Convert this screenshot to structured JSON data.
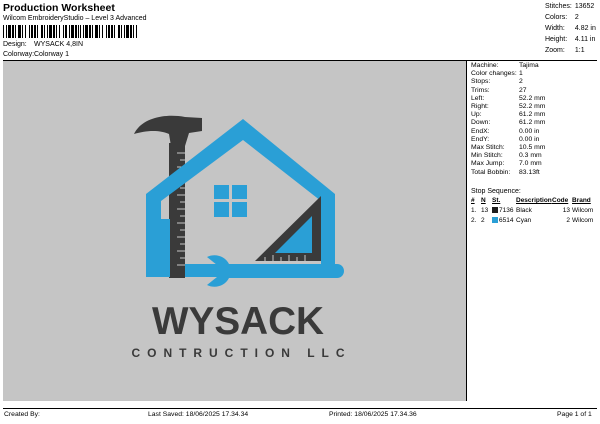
{
  "header": {
    "title": "Production Worksheet",
    "subtitle": "Wilcom EmbroideryStudio – Level 3 Advanced",
    "design_label": "Design:",
    "design_value": "WYSACK 4,8IN",
    "colorway_label": "Colorway:",
    "colorway_value": "Colorway 1"
  },
  "stats": [
    {
      "label": "Stitches:",
      "value": "13652"
    },
    {
      "label": "Colors:",
      "value": "2"
    },
    {
      "label": "Width:",
      "value": "4.82 in"
    },
    {
      "label": "Height:",
      "value": "4.11 in"
    },
    {
      "label": "Zoom:",
      "value": "1:1"
    }
  ],
  "machine_params": [
    {
      "label": "Machine:",
      "value": "Tajima"
    },
    {
      "label": "Color changes:",
      "value": "1"
    },
    {
      "label": "Stops:",
      "value": "2"
    },
    {
      "label": "Trims:",
      "value": "27"
    },
    {
      "label": "Left:",
      "value": "52.2 mm"
    },
    {
      "label": "Right:",
      "value": "52.2 mm"
    },
    {
      "label": "Up:",
      "value": "61.2 mm"
    },
    {
      "label": "Down:",
      "value": "61.2 mm"
    },
    {
      "label": "EndX:",
      "value": "0.00 in"
    },
    {
      "label": "EndY:",
      "value": "0.00 in"
    },
    {
      "label": "Max Stitch:",
      "value": "10.5 mm"
    },
    {
      "label": "Min Stitch:",
      "value": "0.3 mm"
    },
    {
      "label": "Max Jump:",
      "value": "7.0 mm"
    },
    {
      "label": "Total Bobbin:",
      "value": "83.13ft"
    }
  ],
  "stop_sequence": {
    "heading": "Stop Sequence:",
    "columns": [
      "#",
      "N",
      "St.",
      "Description",
      "Code",
      "Brand"
    ],
    "rows": [
      {
        "num": "1.",
        "n": "13",
        "st": "7136",
        "desc": "Black",
        "code": "13",
        "brand": "Wilcom",
        "color": "#1e1e1e"
      },
      {
        "num": "2.",
        "n": "2",
        "st": "6514",
        "desc": "Cyan",
        "code": "2",
        "brand": "Wilcom",
        "color": "#2a9fd6"
      }
    ]
  },
  "design": {
    "brand_name": "WYSACK",
    "tagline": "CONTRUCTION LLC",
    "colors": {
      "dark": "#3a3a3a",
      "cyan": "#2a9fd6",
      "background": "#c5c5c5"
    }
  },
  "footer": {
    "created_by": "Created By:",
    "last_saved": "Last Saved: 18/06/2025 17.34.34",
    "printed": "Printed: 18/06/2025 17.34.36",
    "page": "Page 1 of 1"
  }
}
